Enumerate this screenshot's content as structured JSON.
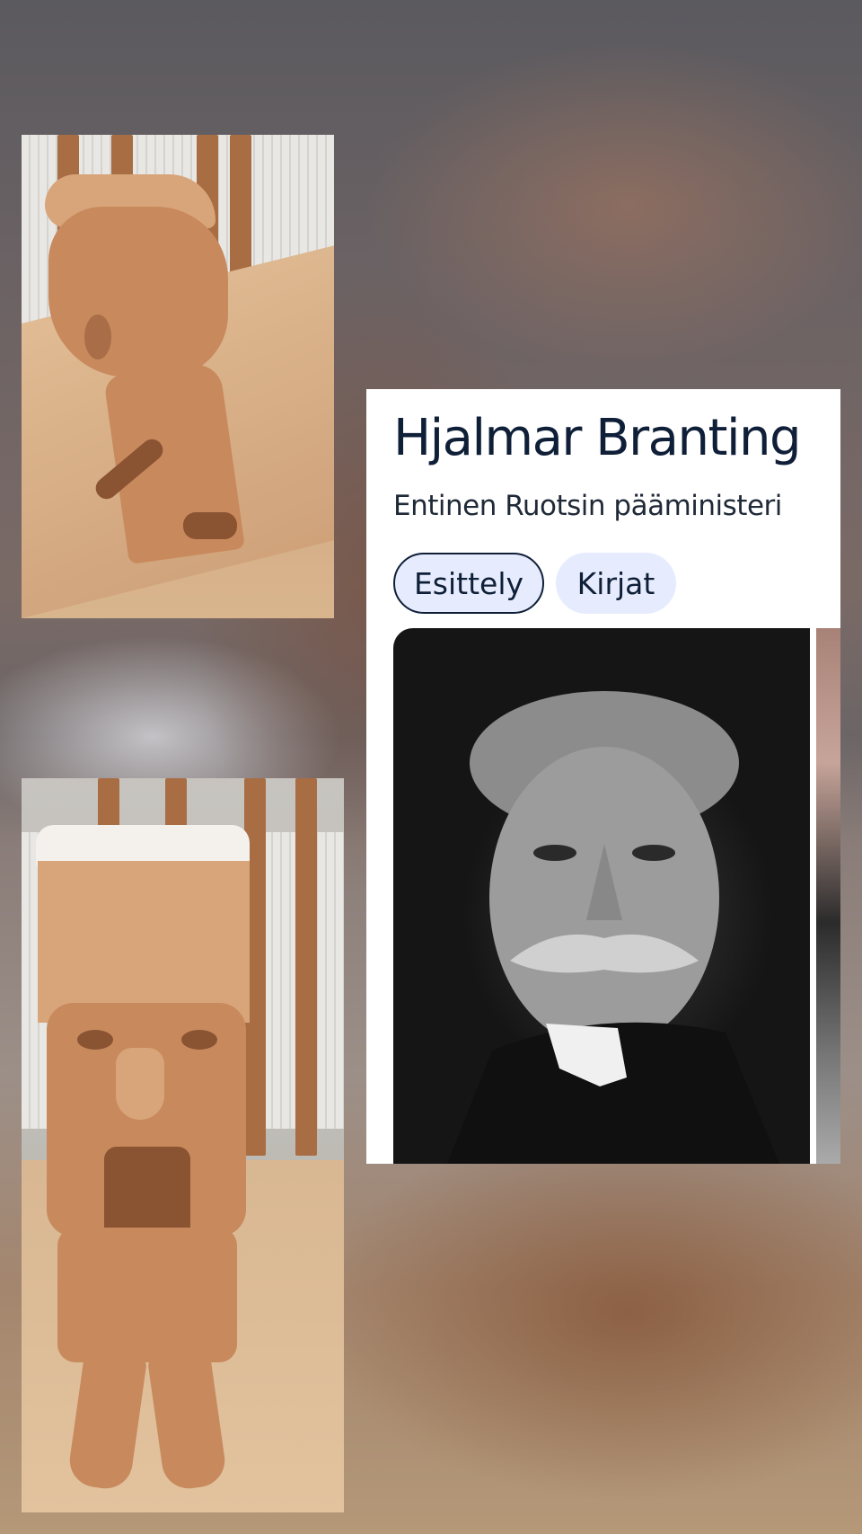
{
  "knowledge_panel": {
    "title": "Hjalmar Branting",
    "subtitle": "Entinen Ruotsin pääministeri",
    "tabs": [
      {
        "label": "Esittely",
        "selected": true
      },
      {
        "label": "Kirjat",
        "selected": false
      }
    ]
  },
  "colors": {
    "title_text": "#0f1f38",
    "chip_background": "#e6ecfd",
    "card_background": "#ffffff"
  }
}
